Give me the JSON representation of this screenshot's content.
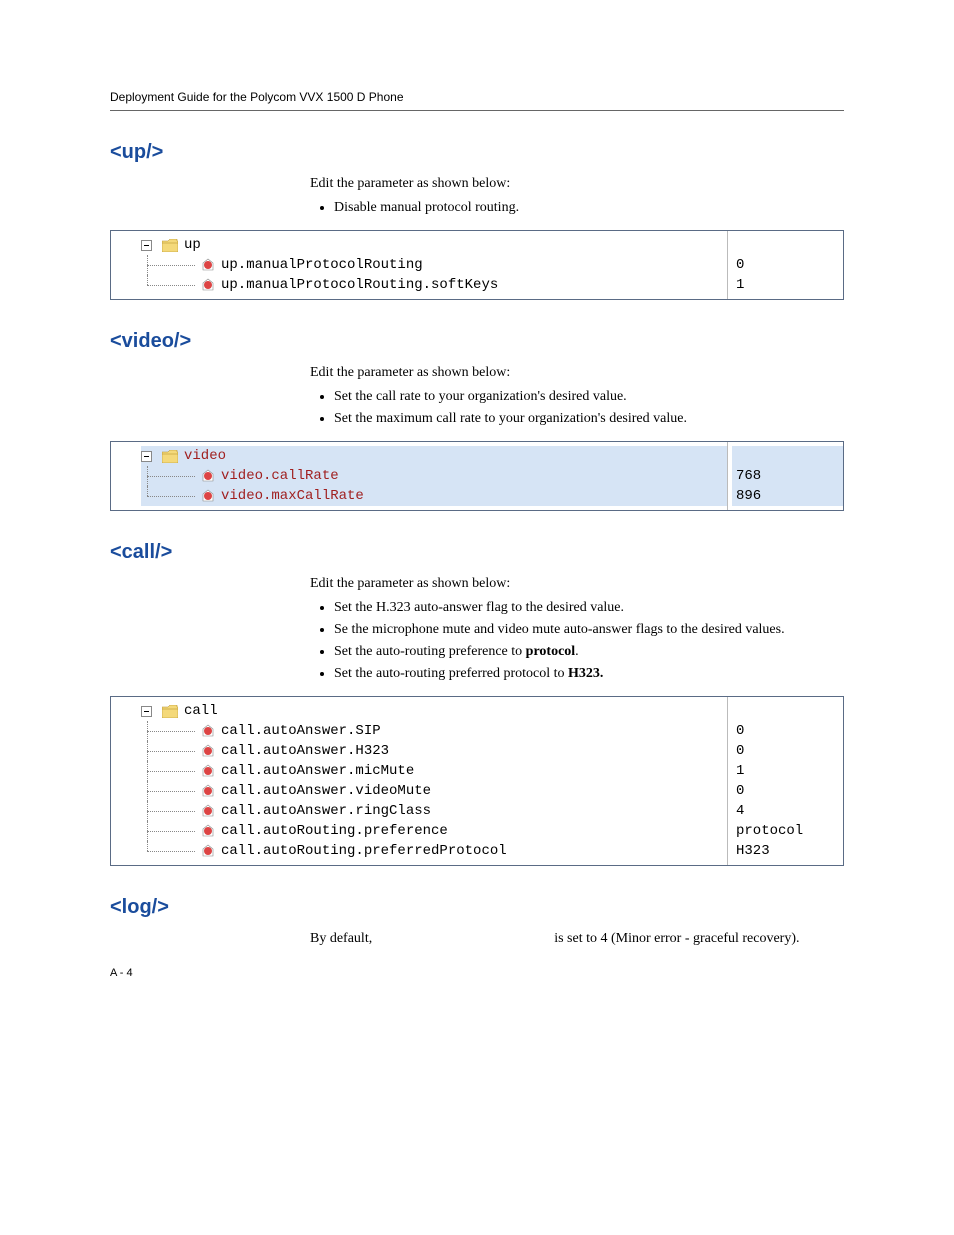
{
  "header": "Deployment Guide for the Polycom VVX 1500 D Phone",
  "page_number": "A - 4",
  "sections": {
    "up": {
      "heading": "<up/>",
      "intro": "Edit the         parameter as shown below:",
      "bullets": [
        "Disable manual protocol routing."
      ],
      "tree": {
        "root": "up",
        "rows": [
          {
            "name": "up.manualProtocolRouting",
            "value": "0"
          },
          {
            "name": "up.manualProtocolRouting.softKeys",
            "value": "1"
          }
        ]
      }
    },
    "video": {
      "heading": "<video/>",
      "intro": "Edit the             parameter as shown below:",
      "bullets": [
        "Set the call rate to your organization's desired value.",
        "Set the maximum call rate to your organization's desired value."
      ],
      "tree": {
        "root": "video",
        "selected": true,
        "rows": [
          {
            "name": "video.callRate",
            "value": "768"
          },
          {
            "name": "video.maxCallRate",
            "value": "896"
          }
        ]
      }
    },
    "call": {
      "heading": "<call/>",
      "intro": "Edit the             parameter as shown below:",
      "bullets": [
        "Set the H.323 auto-answer flag to the desired value.",
        "Se the microphone mute and video mute auto-answer flags to the desired values.",
        {
          "pre": "Set the auto-routing preference to ",
          "bold": "protocol",
          "post": "."
        },
        {
          "pre": "Set the auto-routing preferred protocol to ",
          "bold": "H323.",
          "post": ""
        }
      ],
      "tree": {
        "root": "call",
        "rows": [
          {
            "name": "call.autoAnswer.SIP",
            "value": "0"
          },
          {
            "name": "call.autoAnswer.H323",
            "value": "0"
          },
          {
            "name": "call.autoAnswer.micMute",
            "value": "1"
          },
          {
            "name": "call.autoAnswer.videoMute",
            "value": "0"
          },
          {
            "name": "call.autoAnswer.ringClass",
            "value": "4"
          },
          {
            "name": "call.autoRouting.preference",
            "value": "protocol"
          },
          {
            "name": "call.autoRouting.preferredProtocol",
            "value": "H323"
          }
        ]
      }
    },
    "log": {
      "heading": "<log/>",
      "text": "By default,                                                    is set to 4 (Minor error - graceful recovery)."
    }
  }
}
